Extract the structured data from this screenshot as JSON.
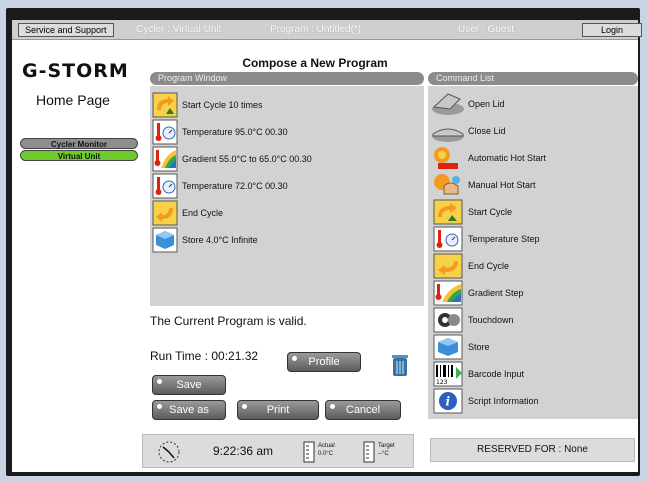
{
  "topbar": {
    "service_support": "Service and Support",
    "cycler": "Cycler : Virtual Unit",
    "program": "Program : Untitled(*)",
    "user": "User : Guest",
    "login": "Login"
  },
  "left": {
    "logo": "G-STORM",
    "home_page": "Home  Page",
    "cycler_monitor": "Cycler Monitor",
    "virtual_unit": "Virtual Unit"
  },
  "main": {
    "title": "Compose a New Program",
    "program_window_label": "Program Window",
    "command_list_label": "Command List",
    "program_steps": [
      {
        "icon": "start-cycle-icon",
        "text": "Start Cycle     10 times"
      },
      {
        "icon": "temperature-icon",
        "text": "Temperature  95.0°C  00.30"
      },
      {
        "icon": "gradient-icon",
        "text": "Gradient   55.0°C to 65.0°C 00.30"
      },
      {
        "icon": "temperature-icon",
        "text": "Temperature  72.0°C  00.30"
      },
      {
        "icon": "end-cycle-icon",
        "text": "End Cycle"
      },
      {
        "icon": "store-icon",
        "text": "Store  4.0°C  Infinite"
      }
    ],
    "valid_message": "The Current Program is valid.",
    "run_time": "Run Time : 00:21.32",
    "buttons": {
      "profile": "Profile",
      "save": "Save",
      "save_as": "Save as",
      "print": "Print",
      "cancel": "Cancel"
    },
    "status": {
      "time": "9:22:36 am",
      "actual_label": "Actual",
      "actual_value": "0.0°C",
      "target_label": "Target",
      "target_value": "--°C"
    }
  },
  "commands": [
    {
      "icon": "open-lid-icon",
      "text": "Open Lid"
    },
    {
      "icon": "close-lid-icon",
      "text": "Close Lid"
    },
    {
      "icon": "automatic-hot-start-icon",
      "text": "Automatic Hot Start"
    },
    {
      "icon": "manual-hot-start-icon",
      "text": "Manual Hot Start"
    },
    {
      "icon": "start-cycle-icon",
      "text": "Start Cycle"
    },
    {
      "icon": "temperature-step-icon",
      "text": "Temperature Step"
    },
    {
      "icon": "end-cycle-icon",
      "text": "End Cycle"
    },
    {
      "icon": "gradient-step-icon",
      "text": "Gradient Step"
    },
    {
      "icon": "touchdown-icon",
      "text": "Touchdown"
    },
    {
      "icon": "store-icon",
      "text": "Store"
    },
    {
      "icon": "barcode-input-icon",
      "text": "Barcode Input"
    },
    {
      "icon": "script-information-icon",
      "text": "Script Information"
    }
  ],
  "reserved": "RESERVED FOR : None",
  "colors": {
    "accent_green": "#6fcb2c",
    "panel_gray": "#d2d2d2"
  }
}
